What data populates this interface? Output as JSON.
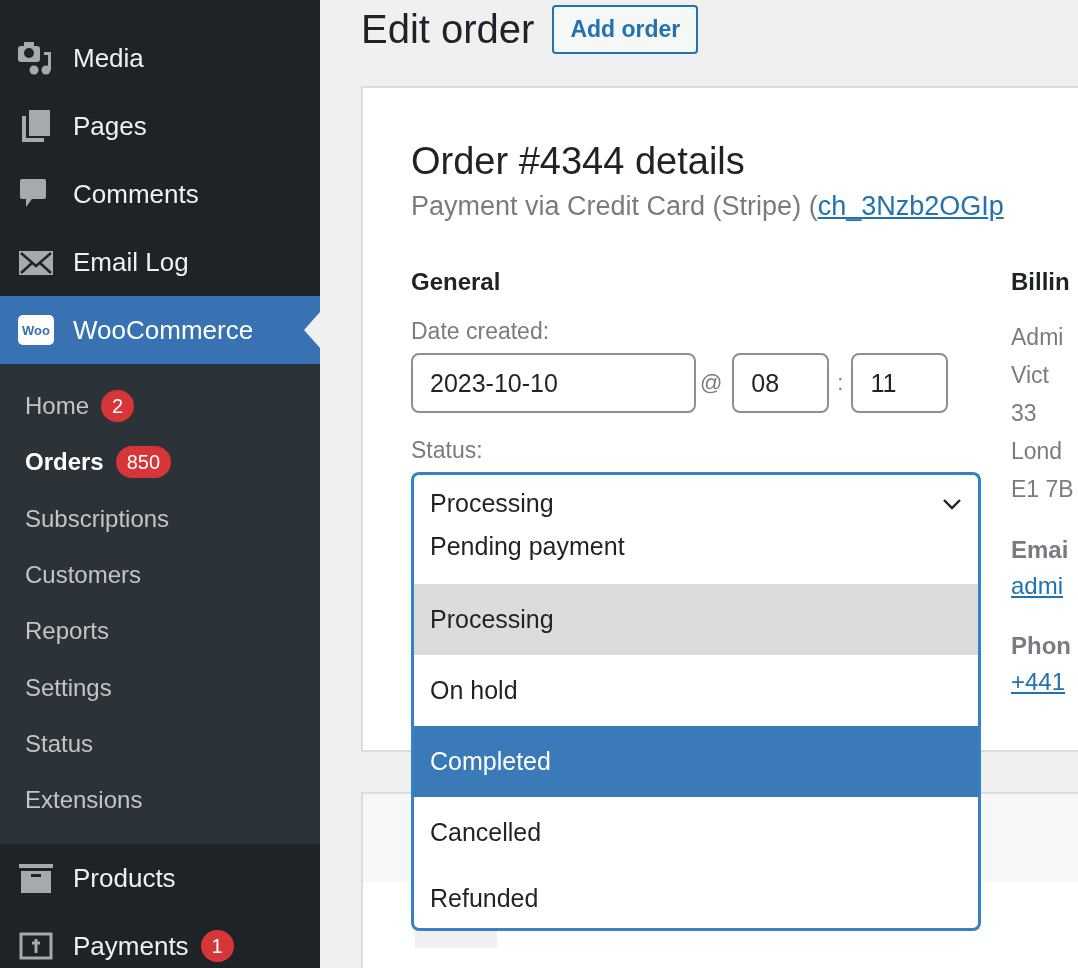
{
  "sidebar": {
    "top_items": [
      {
        "label": "Media"
      },
      {
        "label": "Pages"
      },
      {
        "label": "Comments"
      },
      {
        "label": "Email Log"
      }
    ],
    "current": {
      "label": "WooCommerce",
      "logo": "Woo"
    },
    "sub_items": [
      {
        "label": "Home",
        "badge": "2",
        "selected": false
      },
      {
        "label": "Orders",
        "badge": "850",
        "selected": true
      },
      {
        "label": "Subscriptions",
        "selected": false
      },
      {
        "label": "Customers",
        "selected": false
      },
      {
        "label": "Reports",
        "selected": false
      },
      {
        "label": "Settings",
        "selected": false
      },
      {
        "label": "Status",
        "selected": false
      },
      {
        "label": "Extensions",
        "selected": false
      }
    ],
    "bottom_items": [
      {
        "label": "Products"
      },
      {
        "label": "Payments",
        "badge": "1"
      }
    ]
  },
  "header": {
    "title": "Edit order",
    "button": "Add order"
  },
  "order": {
    "title": "Order #4344 details",
    "payment_text": "Payment via Credit Card (Stripe) (",
    "payment_link": "ch_3Nzb2OGIp",
    "general": {
      "heading": "General",
      "date_label": "Date created:",
      "date": "2023-10-10",
      "at": "@",
      "hour": "08",
      "colon": ":",
      "minute": "11",
      "status_label": "Status:",
      "status_value": "Processing",
      "options": [
        {
          "label": "Pending payment",
          "selected": false,
          "highlighted": false
        },
        {
          "label": "Processing",
          "selected": true,
          "highlighted": false
        },
        {
          "label": "On hold",
          "selected": false,
          "highlighted": false
        },
        {
          "label": "Completed",
          "selected": false,
          "highlighted": true
        },
        {
          "label": "Cancelled",
          "selected": false,
          "highlighted": false
        },
        {
          "label": "Refunded",
          "selected": false,
          "highlighted": false
        }
      ]
    },
    "billing": {
      "heading": "Billin",
      "address": [
        "Admi",
        "Vict",
        "33",
        "Lond",
        "E1 7B"
      ],
      "email_label": "Emai",
      "email": "admi",
      "phone_label": "Phon",
      "phone": "+441"
    }
  }
}
